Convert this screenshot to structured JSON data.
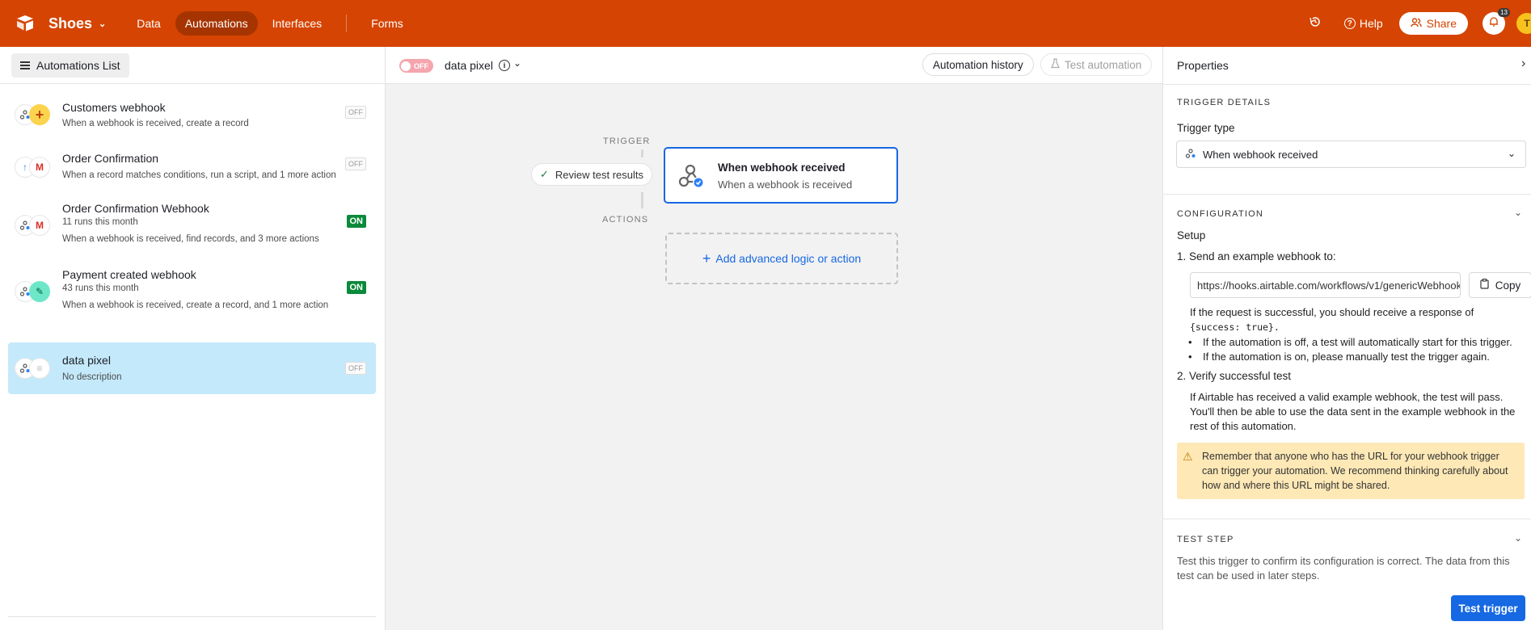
{
  "topbar": {
    "base_name": "Shoes",
    "nav": [
      "Data",
      "Automations",
      "Interfaces",
      "Forms"
    ],
    "active_nav": "Automations",
    "help_label": "Help",
    "share_label": "Share",
    "notification_count": "13",
    "avatar_initial": "T",
    "brand_color": "#d54402"
  },
  "left_panel": {
    "list_button": "Automations List",
    "automations": [
      {
        "title": "Customers webhook",
        "runs": "",
        "description": "When a webhook is received, create a record",
        "status": "OFF",
        "icons": [
          "webhook-icon",
          "plus-icon"
        ]
      },
      {
        "title": "Order Confirmation",
        "runs": "",
        "description": "When a record matches conditions, run a script, and 1 more action",
        "status": "OFF",
        "icons": [
          "record-icon",
          "gmail-icon"
        ]
      },
      {
        "title": "Order Confirmation Webhook",
        "runs": "11 runs this month",
        "description": "When a webhook is received, find records, and 3 more actions",
        "status": "ON",
        "icons": [
          "webhook-icon",
          "gmail-icon"
        ]
      },
      {
        "title": "Payment created webhook",
        "runs": "43 runs this month",
        "description": "When a webhook is received, create a record, and 1 more action",
        "status": "ON",
        "icons": [
          "webhook-icon",
          "pencil-icon"
        ]
      },
      {
        "title": "data pixel",
        "runs": "",
        "description": "No description",
        "status": "OFF",
        "icons": [
          "webhook-icon",
          "list-icon"
        ]
      }
    ],
    "selected_index": 4
  },
  "center": {
    "toggle_label": "OFF",
    "automation_name": "data pixel",
    "history_button": "Automation history",
    "test_button": "Test automation",
    "trigger_label": "TRIGGER",
    "actions_label": "ACTIONS",
    "review_button": "Review test results",
    "trigger_card": {
      "title": "When webhook received",
      "subtitle": "When a webhook is received"
    },
    "add_action": "Add advanced logic or action"
  },
  "right_panel": {
    "title": "Properties",
    "trigger_details_label": "TRIGGER DETAILS",
    "trigger_type_label": "Trigger type",
    "trigger_type_value": "When webhook received",
    "configuration_label": "CONFIGURATION",
    "setup_label": "Setup",
    "step1_label": "1. Send an example webhook to:",
    "webhook_url": "https://hooks.airtable.com/workflows/v1/genericWebhook",
    "copy_label": "Copy",
    "response_text": "If the request is successful, you should receive a response of",
    "response_code": "{success: true}.",
    "bullets": [
      "If the automation is off, a test will automatically start for this trigger.",
      "If the automation is on, please manually test the trigger again."
    ],
    "step2_label": "2. Verify successful test",
    "verify_text": "If Airtable has received a valid example webhook, the test will pass. You'll then be able to use the data sent in the example webhook in the rest of this automation.",
    "warning_text": "Remember that anyone who has the URL for your webhook trigger can trigger your automation. We recommend thinking carefully about how and where this URL might be shared.",
    "test_step_label": "TEST STEP",
    "test_step_text": "Test this trigger to confirm its configuration is correct. The data from this test can be used in later steps.",
    "test_trigger_button": "Test trigger"
  }
}
